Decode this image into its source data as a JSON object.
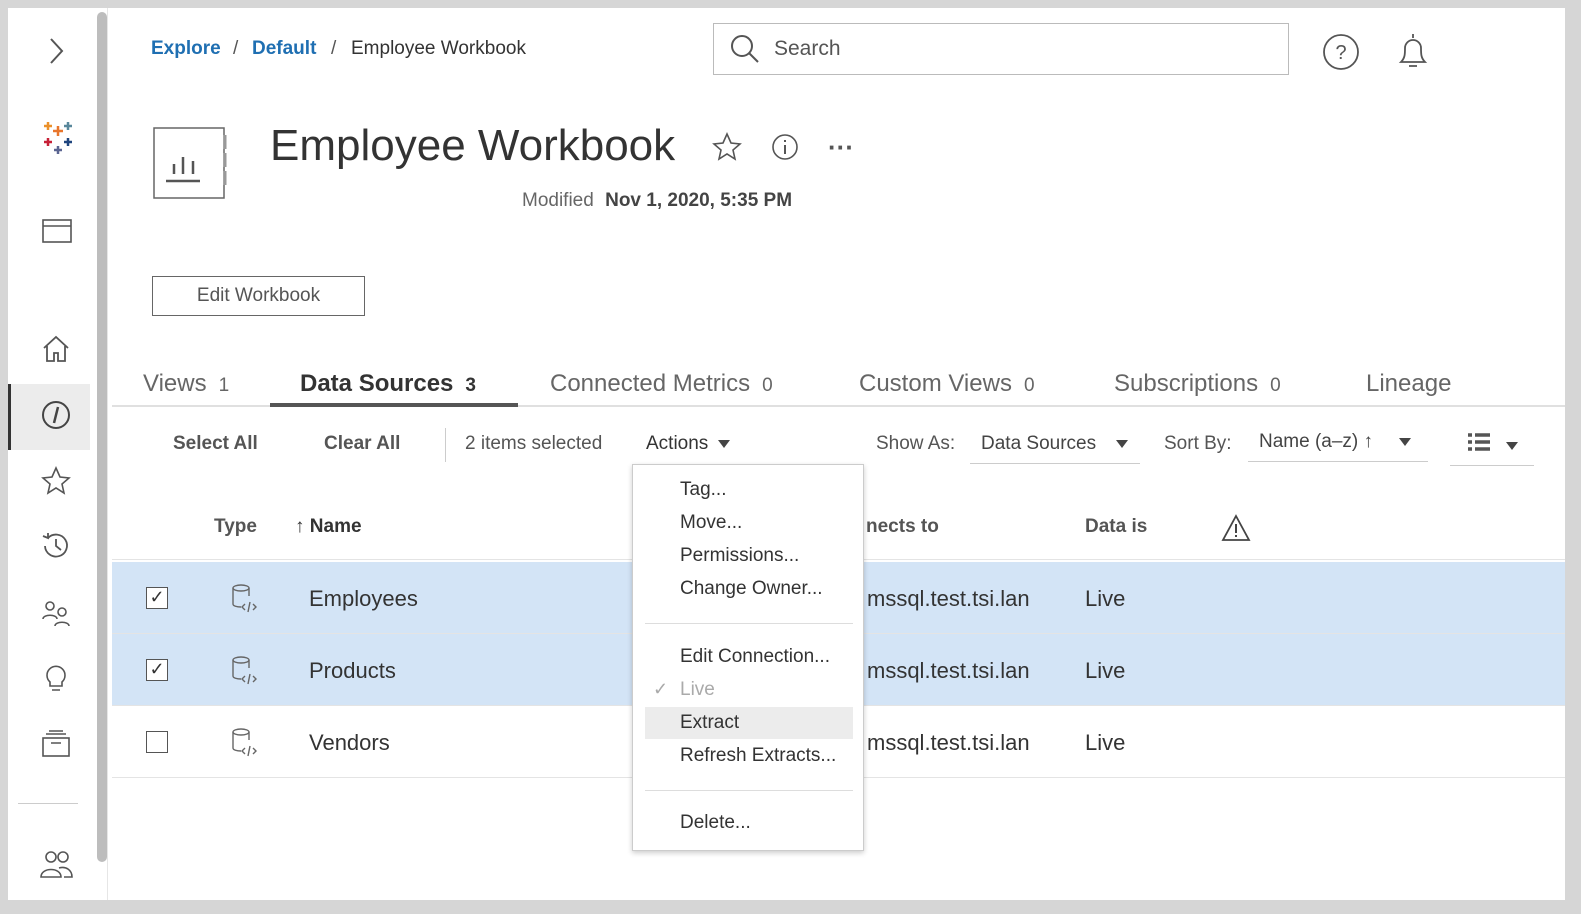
{
  "breadcrumb": {
    "items": [
      "Explore",
      "Default"
    ],
    "current": "Employee Workbook",
    "separator": "/"
  },
  "search": {
    "placeholder": "Search"
  },
  "workbook": {
    "title": "Employee Workbook",
    "modified_label": "Modified",
    "modified_value": "Nov 1, 2020, 5:35 PM",
    "edit_label": "Edit Workbook"
  },
  "tabs": [
    {
      "label": "Views",
      "count": "1"
    },
    {
      "label": "Data Sources",
      "count": "3"
    },
    {
      "label": "Connected Metrics",
      "count": "0"
    },
    {
      "label": "Custom Views",
      "count": "0"
    },
    {
      "label": "Subscriptions",
      "count": "0"
    },
    {
      "label": "Lineage",
      "count": ""
    }
  ],
  "toolbar": {
    "select_all": "Select All",
    "clear_all": "Clear All",
    "selected": "2 items selected",
    "actions": "Actions",
    "show_as_label": "Show As:",
    "show_as_value": "Data Sources",
    "sort_by_label": "Sort By:",
    "sort_by_value": "Name (a–z) ↑"
  },
  "table": {
    "headers": {
      "type": "Type",
      "name": "↑ Name",
      "connects": "nects to",
      "data_is": "Data is"
    },
    "rows": [
      {
        "name": "Employees",
        "connects": "mssql.test.tsi.lan",
        "data_is": "Live",
        "checked": true
      },
      {
        "name": "Products",
        "connects": "mssql.test.tsi.lan",
        "data_is": "Live",
        "checked": true
      },
      {
        "name": "Vendors",
        "connects": "mssql.test.tsi.lan",
        "data_is": "Live",
        "checked": false
      }
    ]
  },
  "menu": {
    "items": [
      "Tag...",
      "Move...",
      "Permissions...",
      "Change Owner...",
      "Edit Connection...",
      "Live",
      "Extract",
      "Refresh Extracts...",
      "Delete..."
    ]
  },
  "colors": {
    "link": "#1f6fb2",
    "selected_row": "#d3e4f6",
    "menu_highlight": "#ececec"
  }
}
